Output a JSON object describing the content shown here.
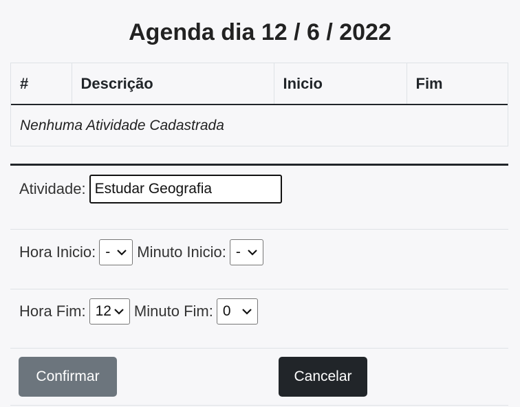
{
  "title": "Agenda dia 12 / 6 / 2022",
  "table": {
    "headers": [
      "#",
      "Descrição",
      "Inicio",
      "Fim"
    ],
    "empty_message": "Nenhuma Atividade Cadastrada"
  },
  "form": {
    "atividade_label": "Atividade:",
    "atividade_value": "Estudar Geografia",
    "hora_inicio_label": "Hora Inicio:",
    "hora_inicio_value": "-",
    "minuto_inicio_label": "Minuto Inicio:",
    "minuto_inicio_value": "-",
    "hora_fim_label": "Hora Fim:",
    "hora_fim_value": "12",
    "minuto_fim_label": "Minuto Fim:",
    "minuto_fim_value": "0"
  },
  "buttons": {
    "confirm_label": "Confirmar",
    "cancel_label": "Cancelar"
  },
  "colors": {
    "confirm_bg": "#6c757d",
    "cancel_bg": "#212529"
  },
  "icons": {
    "select_arrow": "chevron-down-icon"
  }
}
